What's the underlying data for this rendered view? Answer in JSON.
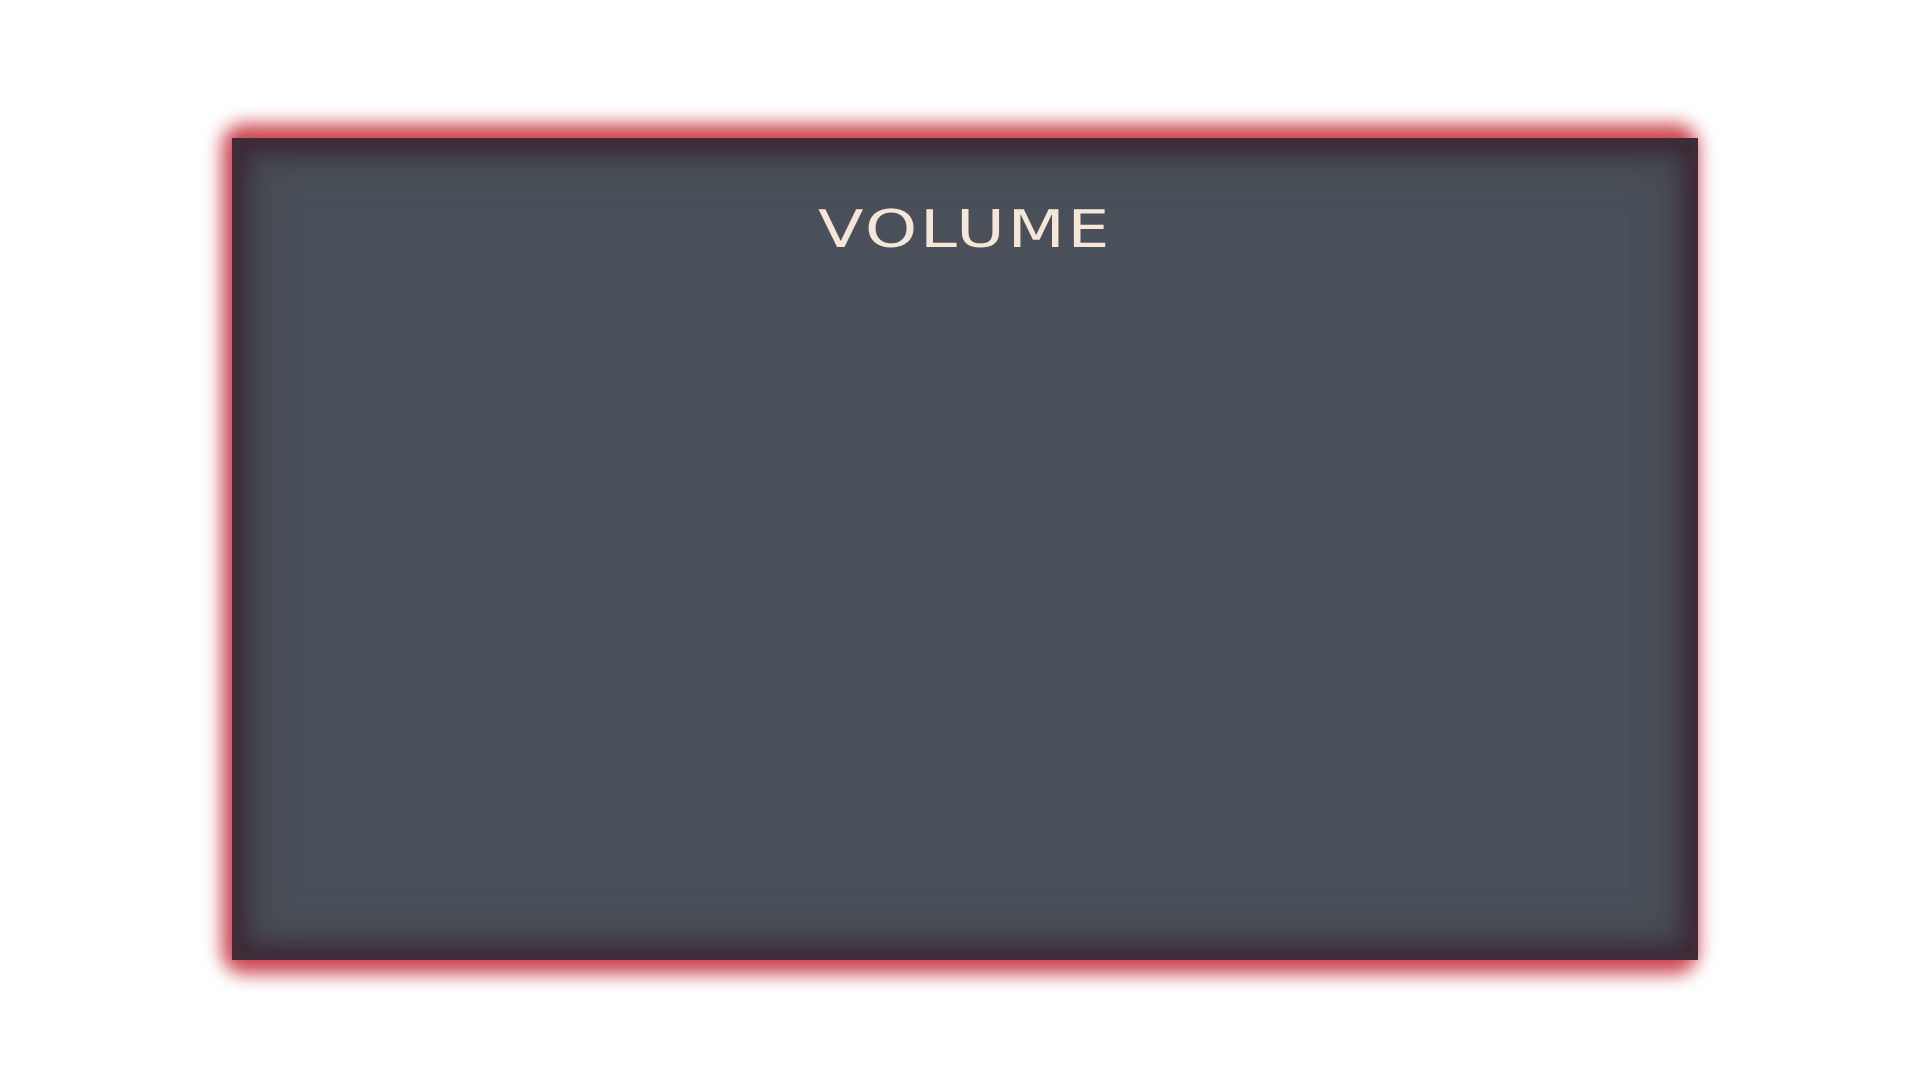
{
  "volume_panel": {
    "title": "VOLUME"
  },
  "colors": {
    "background": "#ffffff",
    "panel_fill": "#495059",
    "panel_border_glow": "#cc4550",
    "panel_inner_shadow": "#3e2c38",
    "title_text": "#f6e6d8"
  }
}
